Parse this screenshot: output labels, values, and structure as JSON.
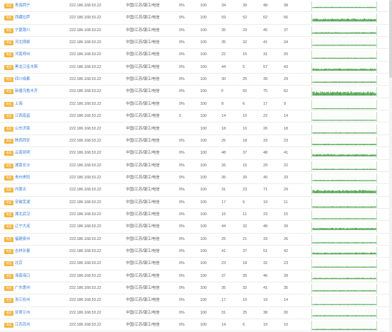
{
  "colors": {
    "badge": "#f3b541",
    "city": "#3d7fd6",
    "spark": "#3c9a3c"
  },
  "rows": [
    {
      "badge": "电信",
      "city": "青海西宁",
      "ip": "222.186.168.53.22",
      "isp": "中国/江苏/镇江/电信",
      "loss": "0%",
      "sent": "100",
      "min": "34",
      "max": "30",
      "avg": "48",
      "last": "38",
      "spark": [
        0.55,
        0.6
      ]
    },
    {
      "badge": "电信",
      "city": "西藏拉萨",
      "ip": "222.186.168.53.22",
      "isp": "中国/江苏/镇江/电信",
      "loss": "0%",
      "sent": "100",
      "min": "59",
      "max": "52",
      "avg": "62",
      "last": "56",
      "spark": [
        0.5,
        0.75
      ]
    },
    {
      "badge": "电信",
      "city": "宁夏银川",
      "ip": "222.186.168.53.22",
      "isp": "中国/江苏/镇江/电信",
      "loss": "0%",
      "sent": "100",
      "min": "35",
      "max": "29",
      "avg": "45",
      "last": "37",
      "spark": [
        0.6,
        0.7
      ]
    },
    {
      "badge": "电信",
      "city": "河北邯郸",
      "ip": "222.186.168.53.22",
      "isp": "中国/江苏/镇江/电信",
      "loss": "0%",
      "sent": "100",
      "min": "35",
      "max": "32",
      "avg": "41",
      "last": "34",
      "spark": [
        0.65,
        0.7
      ]
    },
    {
      "badge": "电信",
      "city": "河南郑州",
      "ip": "222.186.168.53.22",
      "isp": "中国/江苏/镇江/电信",
      "loss": "0%",
      "sent": "100",
      "min": "22",
      "max": "15",
      "avg": "31",
      "last": "20",
      "spark": [
        0.75,
        0.8
      ]
    },
    {
      "badge": "电信",
      "city": "黑龙江佳木斯",
      "ip": "222.186.168.53.22",
      "isp": "中国/江苏/镇江/电信",
      "loss": "0%",
      "sent": "100",
      "min": "44",
      "max": "5",
      "avg": "57",
      "last": "43",
      "spark": [
        0.55,
        0.72
      ]
    },
    {
      "badge": "电信",
      "city": "四川成都",
      "ip": "222.186.168.53.22",
      "isp": "中国/江苏/镇江/电信",
      "loss": "0%",
      "sent": "100",
      "min": "30",
      "max": "25",
      "avg": "39",
      "last": "29",
      "spark": [
        0.65,
        0.72
      ]
    },
    {
      "badge": "电信",
      "city": "新疆乌鲁木齐",
      "ip": "222.186.168.53.22",
      "isp": "中国/江苏/镇江/电信",
      "loss": "0%",
      "sent": "100",
      "min": "F",
      "max": "50",
      "avg": "75",
      "last": "62",
      "spark": [
        0.45,
        0.8
      ]
    },
    {
      "badge": "电信",
      "city": "上海",
      "ip": "222.186.168.53.22",
      "isp": "中国/江苏/镇江/电信",
      "loss": "0%",
      "sent": "100",
      "min": "8",
      "max": "6",
      "avg": "17",
      "last": "9",
      "spark": [
        0.85,
        0.88
      ]
    },
    {
      "badge": "电信",
      "city": "江西南昌",
      "ip": "222.186.168.53.22",
      "isp": "中国/江苏/镇江/电信",
      "loss": "0",
      "sent": "100",
      "min": "14",
      "max": "10",
      "avg": "22",
      "last": "14",
      "spark": [
        0.8,
        0.84
      ]
    },
    {
      "badge": "电信",
      "city": "山东济南",
      "ip": "222.186.168.53.22",
      "isp": "中国/江苏/镇江/电信",
      "loss": "",
      "sent": "100",
      "min": "18",
      "max": "10",
      "avg": "26",
      "last": "18",
      "spark": [
        0.78,
        0.84
      ]
    },
    {
      "badge": "电信",
      "city": "陕西西安",
      "ip": "222.186.168.53.22",
      "isp": "中国/江苏/镇江/电信",
      "loss": "0%",
      "sent": "100",
      "min": "25",
      "max": "18",
      "avg": "33",
      "last": "23",
      "spark": [
        0.72,
        0.8
      ]
    },
    {
      "badge": "电信",
      "city": "云南昆明",
      "ip": "222.186.168.53.22",
      "isp": "中国/江苏/镇江/电信",
      "loss": "0%",
      "sent": "100",
      "min": "48",
      "max": "37",
      "avg": "48",
      "last": "41",
      "spark": [
        0.55,
        0.72
      ]
    },
    {
      "badge": "电信",
      "city": "湖南长沙",
      "ip": "222.186.168.53.22",
      "isp": "中国/江苏/镇江/电信",
      "loss": "0%",
      "sent": "100",
      "min": "26",
      "max": "16",
      "avg": "29",
      "last": "22",
      "spark": [
        0.74,
        0.8
      ]
    },
    {
      "badge": "电信",
      "city": "贵州贵阳",
      "ip": "222.186.168.53.22",
      "isp": "中国/江苏/镇江/电信",
      "loss": "0%",
      "sent": "100",
      "min": "35",
      "max": "30",
      "avg": "40",
      "last": "33",
      "spark": [
        0.66,
        0.72
      ]
    },
    {
      "badge": "电信",
      "city": "内蒙古",
      "ip": "222.186.168.53.22",
      "isp": "中国/江苏/镇江/电信",
      "loss": "0%",
      "sent": "100",
      "min": "31",
      "max": "23",
      "avg": "71",
      "last": "29",
      "spark": [
        0.45,
        0.72
      ]
    },
    {
      "badge": "电信",
      "city": "安徽芜湖",
      "ip": "222.186.168.53.22",
      "isp": "中国/江苏/镇江/电信",
      "loss": "0%",
      "sent": "100",
      "min": "17",
      "max": "6",
      "avg": "19",
      "last": "11",
      "spark": [
        0.82,
        0.9
      ]
    },
    {
      "badge": "电信",
      "city": "湖北武汉",
      "ip": "222.186.168.53.22",
      "isp": "中国/江苏/镇江/电信",
      "loss": "0%",
      "sent": "100",
      "min": "16",
      "max": "11",
      "avg": "23",
      "last": "15",
      "spark": [
        0.8,
        0.85
      ]
    },
    {
      "badge": "电信",
      "city": "辽宁大连",
      "ip": "222.186.168.53.22",
      "isp": "中国/江苏/镇江/电信",
      "loss": "0%",
      "sent": "100",
      "min": "44",
      "max": "32",
      "avg": "48",
      "last": "39",
      "spark": [
        0.56,
        0.72
      ]
    },
    {
      "badge": "电信",
      "city": "福建泉州",
      "ip": "222.186.168.53.22",
      "isp": "中国/江苏/镇江/电信",
      "loss": "0%",
      "sent": "100",
      "min": "25",
      "max": "21",
      "avg": "33",
      "last": "26",
      "spark": [
        0.72,
        0.78
      ]
    },
    {
      "badge": "电信",
      "city": "吉林长春",
      "ip": "222.186.168.53.22",
      "isp": "中国/江苏/镇江/电信",
      "loss": "0%",
      "sent": "100",
      "min": "41",
      "max": "37",
      "avg": "51",
      "last": "42",
      "spark": [
        0.55,
        0.68
      ]
    },
    {
      "badge": "电信",
      "city": "北京",
      "ip": "222.186.168.53.22",
      "isp": "中国/江苏/镇江/电信",
      "loss": "0%",
      "sent": "100",
      "min": "23",
      "max": "18",
      "avg": "32",
      "last": "23",
      "spark": [
        0.75,
        0.8
      ]
    },
    {
      "badge": "电信",
      "city": "海南海口",
      "ip": "222.186.168.53.22",
      "isp": "中国/江苏/镇江/电信",
      "loss": "0%",
      "sent": "100",
      "min": "37",
      "max": "35",
      "avg": "46",
      "last": "39",
      "spark": [
        0.6,
        0.68
      ]
    },
    {
      "badge": "电信",
      "city": "广东惠州",
      "ip": "222.186.168.53.22",
      "isp": "中国/江苏/镇江/电信",
      "loss": "0%",
      "sent": "100",
      "min": "35",
      "max": "32",
      "avg": "41",
      "last": "35",
      "spark": [
        0.64,
        0.7
      ]
    },
    {
      "badge": "电信",
      "city": "浙江杭州",
      "ip": "222.186.168.53.22",
      "isp": "中国/江苏/镇江/电信",
      "loss": "0%",
      "sent": "100",
      "min": "17",
      "max": "10",
      "avg": "19",
      "last": "14",
      "spark": [
        0.82,
        0.86
      ]
    },
    {
      "badge": "电信",
      "city": "甘肃兰州",
      "ip": "222.186.168.53.22",
      "isp": "中国/江苏/镇江/电信",
      "loss": "0%",
      "sent": "100",
      "min": "31",
      "max": "25",
      "avg": "38",
      "last": "30",
      "spark": [
        0.66,
        0.72
      ]
    },
    {
      "badge": "电信",
      "city": "江苏苏州",
      "ip": "222.186.168.53.22",
      "isp": "中国/江苏/镇江/电信",
      "loss": "0%",
      "sent": "100",
      "min": "14",
      "max": "6",
      "avg": "19",
      "last": "10",
      "spark": [
        0.82,
        0.88
      ]
    }
  ]
}
